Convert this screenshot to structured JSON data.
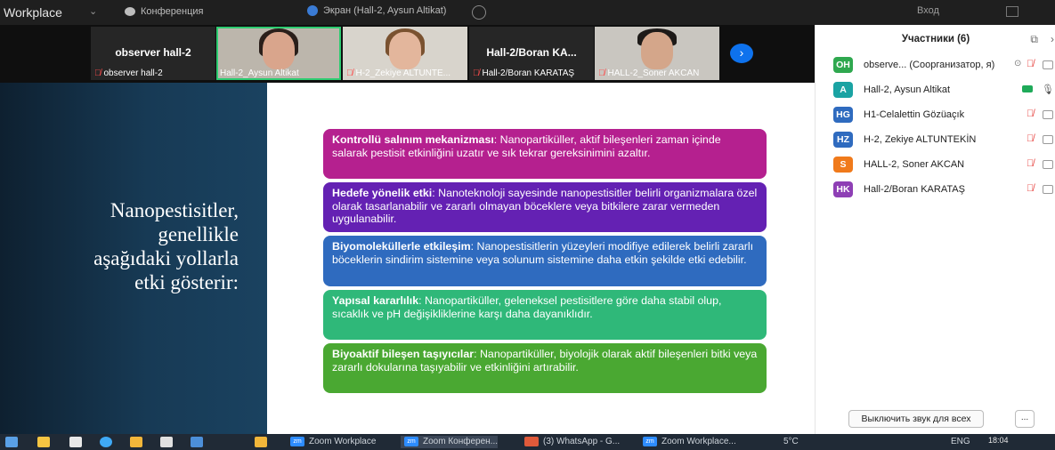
{
  "titlebar": {
    "app_name": "Workplace",
    "meeting_label": "Конференция",
    "screen_label": "Экран (Hall-2, Aysun Altikat)",
    "login": "Вход"
  },
  "videos": [
    {
      "big_name": "observer hall-2",
      "caption": "observer hall-2",
      "has_video": false
    },
    {
      "big_name": "",
      "caption": "Hall-2_Aysun Altikat",
      "has_video": true,
      "active": true
    },
    {
      "big_name": "",
      "caption": "H-2_Zekiye ALTUNTE...",
      "has_video": true
    },
    {
      "big_name": "Hall-2/Boran KA...",
      "caption": "Hall-2/Boran KARATAŞ",
      "has_video": false
    },
    {
      "big_name": "",
      "caption": "HALL-2_Soner AKCAN",
      "has_video": true
    }
  ],
  "slide": {
    "headline_lines": [
      "Nanopestisitler,",
      "genellikle",
      "aşağıdaki yollarla",
      "etki gösterir:"
    ],
    "cards": [
      {
        "title": "Kontrollü salınım mekanizması",
        "text": ": Nanopartiküller, aktif bileşenleri zaman içinde salarak pestisit etkinliğini uzatır ve sık tekrar gereksinimini azaltır.",
        "color": "#b5208f"
      },
      {
        "title": "Hedefe yönelik etki",
        "text": ": Nanoteknoloji sayesinde nanopestisitler belirli organizmalara özel olarak tasarlanabilir ve zararlı olmayan böceklere veya bitkilere zarar vermeden uygulanabilir.",
        "color": "#6421b3"
      },
      {
        "title": "Biyomoleküllerle etkileşim",
        "text": ": Nanopestisitlerin yüzeyleri modifiye edilerek belirli zararlı böceklerin sindirim sistemine veya solunum sistemine daha etkin şekilde etki edebilir.",
        "color": "#2f6bbf"
      },
      {
        "title": "Yapısal kararlılık",
        "text": ": Nanopartiküller, geleneksel pestisitlere göre daha stabil olup, sıcaklık ve pH değişikliklerine karşı daha dayanıklıdır.",
        "color": "#2fb879"
      },
      {
        "title": "Biyoaktif bileşen taşıyıcılar",
        "text": ": Nanopartiküller, biyolojik olarak aktif bileşenleri bitki veya zararlı dokularına taşıyabilir ve etkinliğini artırabilir.",
        "color": "#4aa832"
      }
    ]
  },
  "participants": {
    "title": "Участники (6)",
    "list": [
      {
        "initials": "OH",
        "name": "observe... (Соорганизатор, я)",
        "color": "#2fa84f",
        "muted": true
      },
      {
        "initials": "A",
        "name": "Hall-2, Aysun Altikat",
        "color": "#1aa3a3",
        "muted": false
      },
      {
        "initials": "HG",
        "name": "H1-Celalettin Gözüaçık",
        "color": "#2f6bbf",
        "muted": true
      },
      {
        "initials": "HZ",
        "name": "H-2, Zekiye ALTUNTEKİN",
        "color": "#2f6bbf",
        "muted": true
      },
      {
        "initials": "S",
        "name": "HALL-2, Soner AKCAN",
        "color": "#f07a1b",
        "muted": true
      },
      {
        "initials": "HK",
        "name": "Hall-2/Boran KARATAŞ",
        "color": "#8e3fb5",
        "muted": true
      }
    ],
    "mute_all": "Выключить звук для всех",
    "more": "..."
  },
  "taskbar": {
    "items": [
      {
        "label": "Zoom Workplace",
        "active": false
      },
      {
        "label": "Zoom Конферен...",
        "active": true
      },
      {
        "label": "(3) WhatsApp - G...",
        "active": false
      },
      {
        "label": "Zoom Workplace...",
        "active": false
      }
    ],
    "temp": "5°C",
    "lang": "ENG",
    "time": "18:04"
  }
}
